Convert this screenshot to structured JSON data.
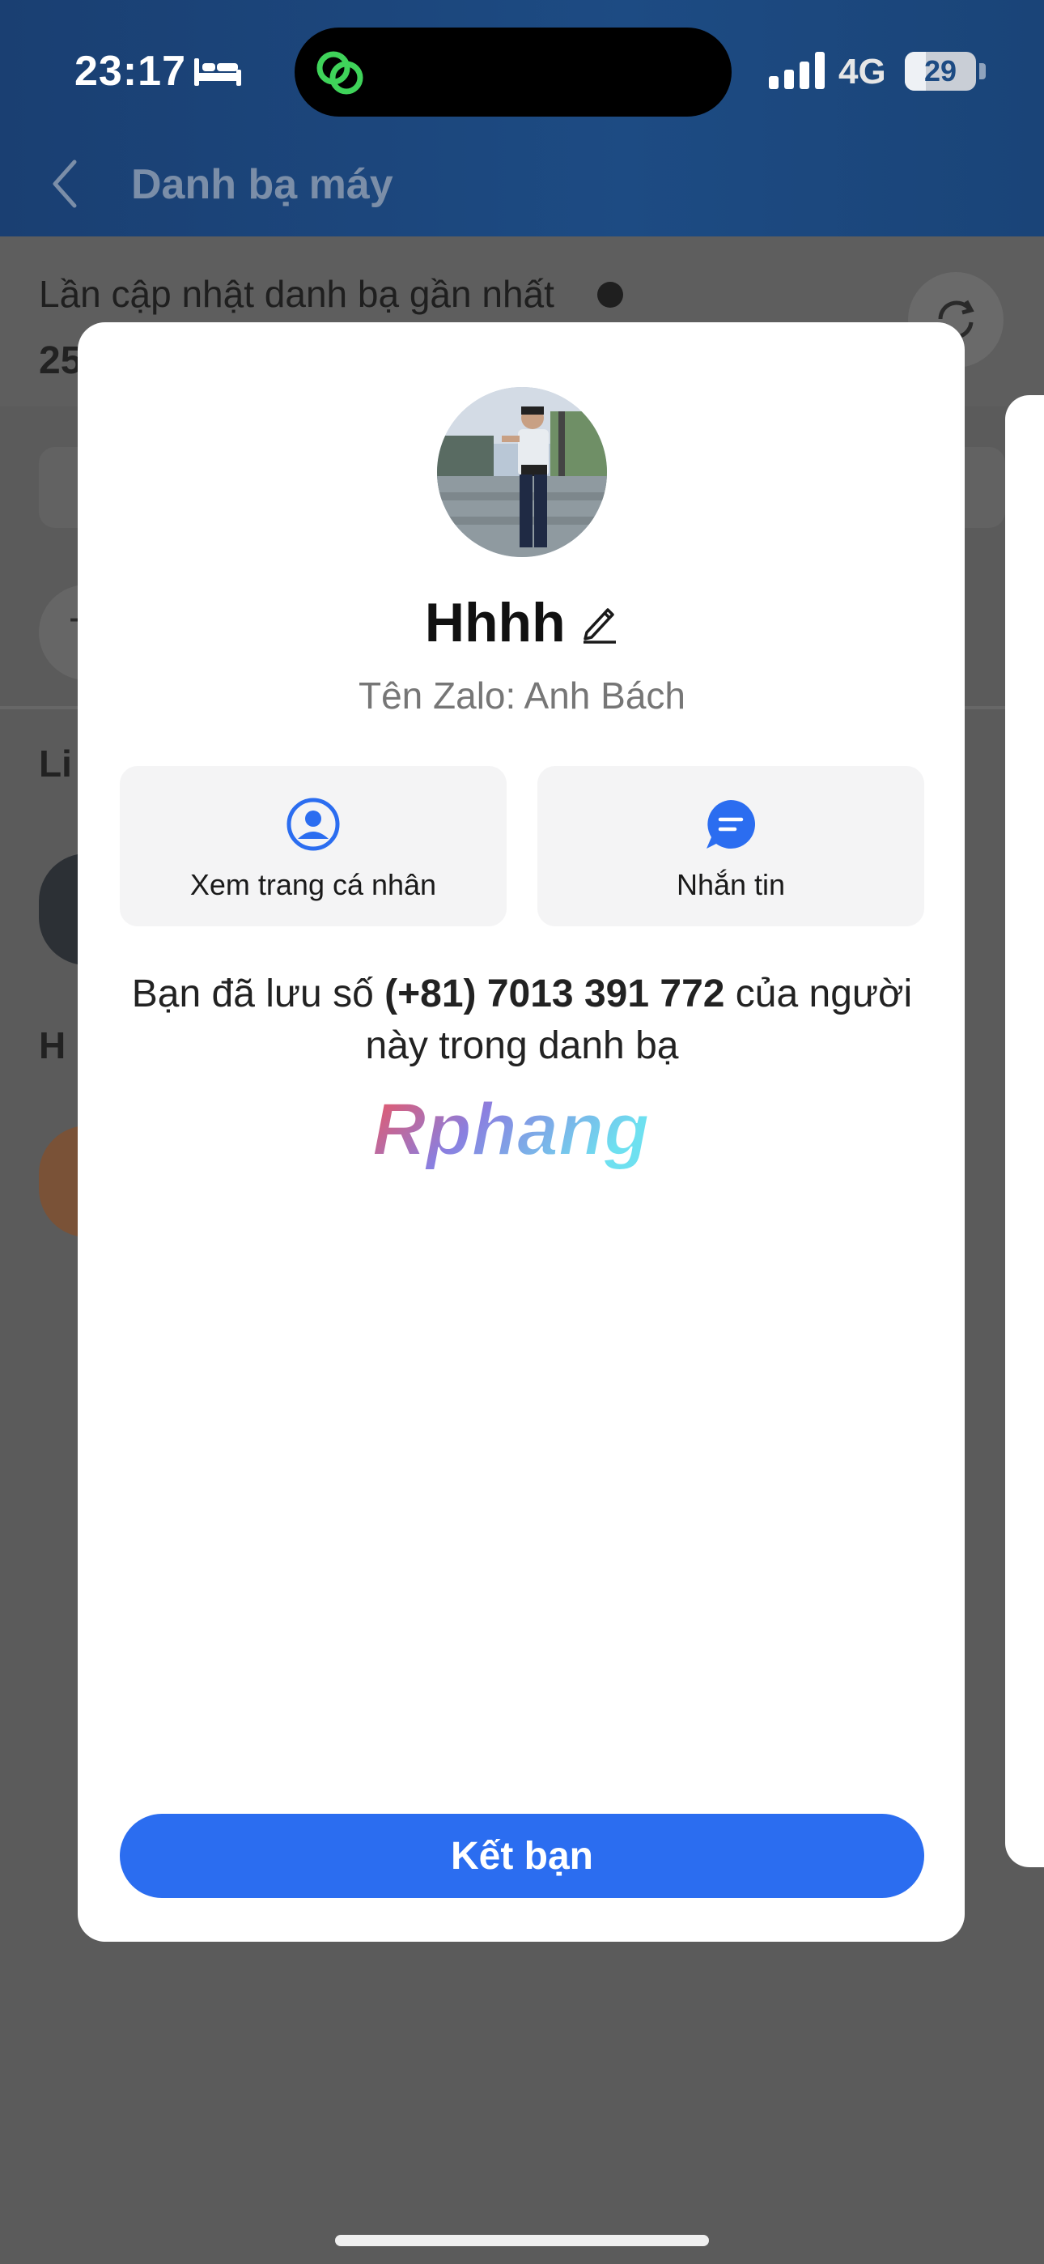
{
  "status_bar": {
    "time": "23:17",
    "network": "4G",
    "battery_level": "29",
    "battery_fraction": 0.29,
    "icons": [
      "bed-icon",
      "chain-link-icon",
      "signal-icon",
      "battery-icon"
    ]
  },
  "nav": {
    "title": "Danh bạ máy",
    "back_icon": "chevron-left-icon"
  },
  "background": {
    "update_label": "Lần cập nhật danh bạ gần nhất",
    "update_value_partial": "25",
    "row_letter_partial": "T",
    "section_partial": "Li",
    "section_h": "H"
  },
  "modal": {
    "contact_name": "Hhhh",
    "zalo_name": "Tên Zalo: Anh Bách",
    "actions": [
      {
        "label": "Xem trang cá nhân",
        "icon": "user-profile-icon"
      },
      {
        "label": "Nhắn tin",
        "icon": "message-icon"
      }
    ],
    "saved_prefix": "Bạn đã lưu số ",
    "saved_number": "(+81) 7013 391 772",
    "saved_suffix": " của người này trong danh bạ",
    "watermark": "Rphang",
    "add_friend_label": "Kết bạn"
  },
  "colors": {
    "primary": "#2b6df0",
    "header": "#1d4b83",
    "overlay": "#5a5a5a",
    "watermark_gradient": [
      "#f0545c",
      "#3aa0f0",
      "#6ee0f0"
    ]
  }
}
